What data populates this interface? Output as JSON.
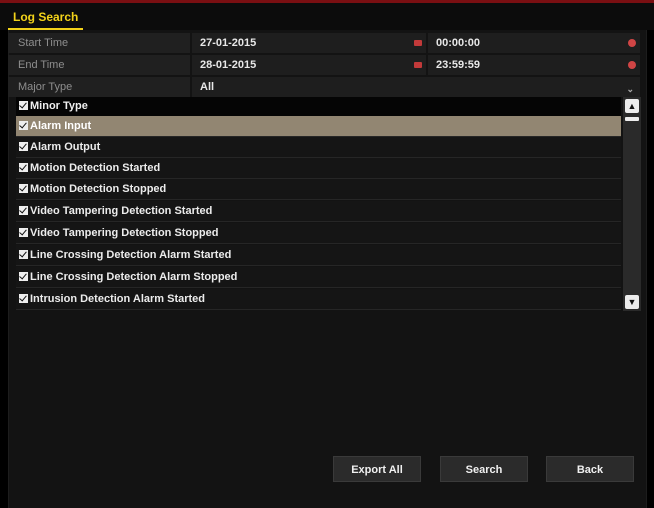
{
  "tab": {
    "label": "Log Search"
  },
  "form": {
    "start_time": {
      "label": "Start Time",
      "date": "27-01-2015",
      "time": "00:00:00"
    },
    "end_time": {
      "label": "End Time",
      "date": "28-01-2015",
      "time": "23:59:59"
    },
    "major_type": {
      "label": "Major Type",
      "value": "All"
    }
  },
  "minor_type": {
    "header": "Minor Type",
    "items": [
      {
        "label": "Alarm Input",
        "checked": true,
        "selected": true
      },
      {
        "label": "Alarm Output",
        "checked": true
      },
      {
        "label": "Motion Detection Started",
        "checked": true
      },
      {
        "label": "Motion Detection Stopped",
        "checked": true
      },
      {
        "label": "Video Tampering Detection Started",
        "checked": true
      },
      {
        "label": "Video Tampering Detection Stopped",
        "checked": true
      },
      {
        "label": "Line Crossing Detection Alarm Started",
        "checked": true
      },
      {
        "label": "Line Crossing Detection Alarm Stopped",
        "checked": true
      },
      {
        "label": "Intrusion Detection Alarm Started",
        "checked": true
      }
    ]
  },
  "buttons": {
    "export_all": "Export All",
    "search": "Search",
    "back": "Back"
  },
  "icons": {
    "checkbox": "checkbox-checked-icon",
    "calendar": "calendar-icon",
    "clock": "clock-icon",
    "dropdown": "chevron-down-icon"
  },
  "colors": {
    "accent": "#f2d21a",
    "selected_row": "#928672",
    "title_bar": "#7a0f12"
  }
}
